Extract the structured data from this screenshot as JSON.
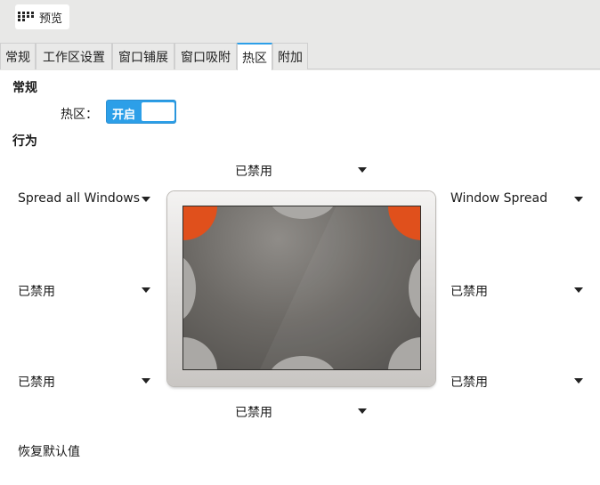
{
  "toolbar": {
    "preview_label": "预览"
  },
  "tabs": [
    {
      "label": "常规"
    },
    {
      "label": "工作区设置"
    },
    {
      "label": "窗口铺展"
    },
    {
      "label": "窗口吸附"
    },
    {
      "label": "热区",
      "active": true
    },
    {
      "label": "附加"
    }
  ],
  "sections": {
    "general": "常规",
    "behavior": "行为"
  },
  "hotzone": {
    "label": "热区：",
    "toggle_state": "开启"
  },
  "actions": {
    "top": "已禁用",
    "top_left": "Spread all Windows",
    "top_right": "Window Spread",
    "left": "已禁用",
    "right": "已禁用",
    "bottom_left": "已禁用",
    "bottom_right": "已禁用",
    "bottom": "已禁用"
  },
  "reset_label": "恢复默认值",
  "colors": {
    "accent": "#2c9fe8",
    "active_corner": "#e0501c",
    "inactive_zone": "#aaa8a5"
  }
}
